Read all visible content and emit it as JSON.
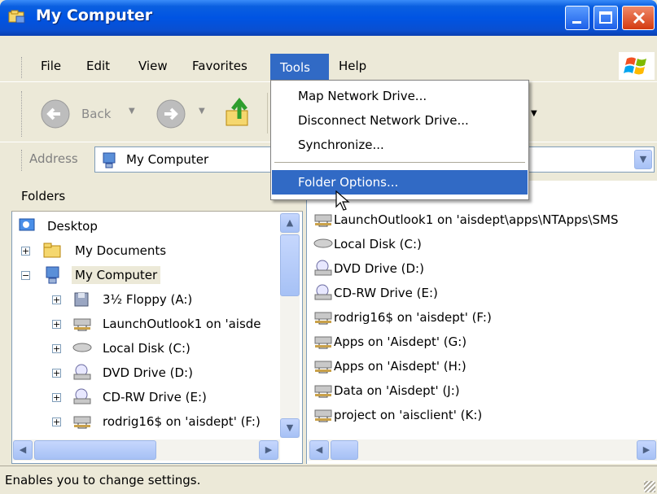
{
  "window": {
    "title": "My Computer"
  },
  "menubar": {
    "items": [
      {
        "label": "File",
        "key": "F"
      },
      {
        "label": "Edit",
        "key": "E"
      },
      {
        "label": "View",
        "key": "V"
      },
      {
        "label": "Favorites",
        "key": "a"
      },
      {
        "label": "Tools",
        "key": "T",
        "active": true
      },
      {
        "label": "Help",
        "key": "H"
      }
    ]
  },
  "toolbar": {
    "back_label": "Back"
  },
  "address": {
    "label": "Address",
    "value": "My Computer"
  },
  "tools_menu": {
    "items": [
      {
        "label": "Map Network Drive..."
      },
      {
        "label": "Disconnect Network Drive..."
      },
      {
        "label": "Synchronize..."
      },
      {
        "label": "Folder Options...",
        "highlighted": true
      }
    ]
  },
  "folders_pane": {
    "title": "Folders",
    "tree": [
      {
        "label": "Desktop",
        "icon": "desktop-icon",
        "indent": 0,
        "expander": ""
      },
      {
        "label": "My Documents",
        "icon": "folder-icon",
        "indent": 1,
        "expander": "+"
      },
      {
        "label": "My Computer",
        "icon": "computer-icon",
        "indent": 1,
        "expander": "-",
        "selected": true
      },
      {
        "label": "3½ Floppy (A:)",
        "icon": "floppy-drive-icon",
        "indent": 2,
        "expander": "+"
      },
      {
        "label": "LaunchOutlook1 on 'aisde",
        "icon": "network-drive-icon",
        "indent": 2,
        "expander": "+"
      },
      {
        "label": "Local Disk (C:)",
        "icon": "local-disk-icon",
        "indent": 2,
        "expander": "+"
      },
      {
        "label": "DVD Drive (D:)",
        "icon": "dvd-drive-icon",
        "indent": 2,
        "expander": "+"
      },
      {
        "label": "CD-RW Drive (E:)",
        "icon": "cd-drive-icon",
        "indent": 2,
        "expander": "+"
      },
      {
        "label": "rodrig16$ on 'aisdept' (F:)",
        "icon": "network-drive-icon",
        "indent": 2,
        "expander": "+"
      }
    ]
  },
  "right_pane": {
    "items": [
      {
        "label": "LaunchOutlook1 on 'aisdept\\apps\\NTApps\\SMS",
        "icon": "network-drive-icon"
      },
      {
        "label": "Local Disk (C:)",
        "icon": "local-disk-icon"
      },
      {
        "label": "DVD Drive (D:)",
        "icon": "dvd-drive-icon"
      },
      {
        "label": "CD-RW Drive (E:)",
        "icon": "cd-drive-icon"
      },
      {
        "label": "rodrig16$ on 'aisdept' (F:)",
        "icon": "network-drive-icon"
      },
      {
        "label": "Apps on 'Aisdept' (G:)",
        "icon": "network-drive-icon"
      },
      {
        "label": "Apps on 'Aisdept' (H:)",
        "icon": "network-drive-icon"
      },
      {
        "label": "Data on 'Aisdept' (J:)",
        "icon": "network-drive-icon"
      },
      {
        "label": "project on 'aisclient' (K:)",
        "icon": "network-drive-icon"
      }
    ]
  },
  "statusbar": {
    "text": "Enables you to change settings."
  },
  "colors": {
    "title_blue": "#0054e3",
    "menu_highlight": "#316ac5",
    "window_face": "#ece9d8"
  }
}
